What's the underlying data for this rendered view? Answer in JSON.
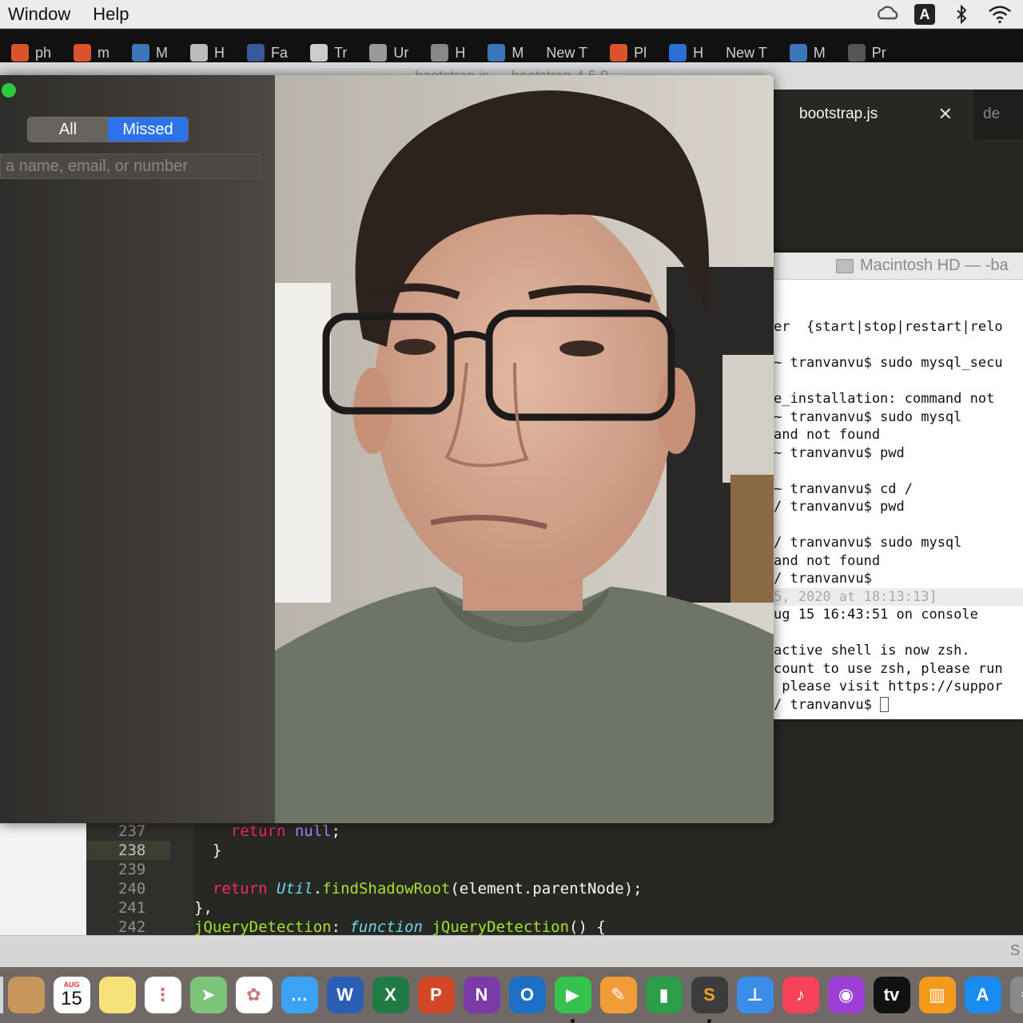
{
  "menubar": {
    "menus": [
      "Window",
      "Help"
    ],
    "status_a": "A"
  },
  "bookmarks": [
    {
      "label": "ph",
      "color": "#d9542b"
    },
    {
      "label": "m",
      "color": "#d9542b"
    },
    {
      "label": "M",
      "color": "#3a76b8"
    },
    {
      "label": "H",
      "color": "#bbbbbb"
    },
    {
      "label": "Fa",
      "color": "#3b5998"
    },
    {
      "label": "Tr",
      "color": "#cccccc"
    },
    {
      "label": "Ur",
      "color": "#999999"
    },
    {
      "label": "H",
      "color": "#888888"
    },
    {
      "label": "M",
      "color": "#3a76b8"
    },
    {
      "label": "New T",
      "color": ""
    },
    {
      "label": "Pl",
      "color": "#d9542b"
    },
    {
      "label": "H",
      "color": "#2b6fd6"
    },
    {
      "label": "New T",
      "color": ""
    },
    {
      "label": "M",
      "color": "#3a76b8"
    },
    {
      "label": "Pr",
      "color": "#555555"
    }
  ],
  "editor": {
    "title": "bootstrap.js — bootstrap-4.5.0",
    "tab_active": "bootstrap.js",
    "tab_next": "de",
    "line_numbers": [
      "237",
      "238",
      "239",
      "240",
      "241",
      "242"
    ]
  },
  "terminal": {
    "title": "Macintosh HD — -ba",
    "lines": [
      "er  {start|stop|restart|relo",
      "",
      "~ tranvanvu$ sudo mysql_secu",
      "",
      "e_installation: command not",
      "~ tranvanvu$ sudo mysql",
      "and not found",
      "~ tranvanvu$ pwd",
      "",
      "~ tranvanvu$ cd /",
      "/ tranvanvu$ pwd",
      "",
      "/ tranvanvu$ sudo mysql",
      "and not found",
      "/ tranvanvu$",
      "5, 2020 at 18:13:13]",
      "ug 15 16:43:51 on console",
      "",
      "active shell is now zsh.",
      "count to use zsh, please run",
      " please visit https://suppor",
      "/ tranvanvu$ "
    ]
  },
  "facetime": {
    "seg_all": "All",
    "seg_missed": "Missed",
    "search_placeholder": "a name, email, or number"
  },
  "statusbar": {
    "right": "S"
  },
  "dock": {
    "calendar_month": "AUG",
    "calendar_day": "15",
    "apps": [
      {
        "name": "contacts",
        "color": "#c8955a",
        "glyph": ""
      },
      {
        "name": "calendar",
        "color": "#ffffff",
        "glyph": ""
      },
      {
        "name": "notes",
        "color": "#f7e27a",
        "glyph": ""
      },
      {
        "name": "reminders",
        "color": "#ffffff",
        "glyph": "⋮"
      },
      {
        "name": "maps",
        "color": "#7cc47a",
        "glyph": "➤"
      },
      {
        "name": "photos",
        "color": "#ffffff",
        "glyph": "✿"
      },
      {
        "name": "messages",
        "color": "#3aa3f5",
        "glyph": "…"
      },
      {
        "name": "word",
        "color": "#2b5fb6",
        "glyph": "W"
      },
      {
        "name": "excel",
        "color": "#1f7a44",
        "glyph": "X"
      },
      {
        "name": "powerpoint",
        "color": "#d24726",
        "glyph": "P"
      },
      {
        "name": "onenote",
        "color": "#7a3aa8",
        "glyph": "N"
      },
      {
        "name": "outlook",
        "color": "#1d6fc6",
        "glyph": "O"
      },
      {
        "name": "facetime",
        "color": "#35c24d",
        "glyph": "▶"
      },
      {
        "name": "pages",
        "color": "#f29c38",
        "glyph": "✎"
      },
      {
        "name": "numbers",
        "color": "#2e9d4a",
        "glyph": "▮"
      },
      {
        "name": "sublime",
        "color": "#3c3c3c",
        "glyph": "S"
      },
      {
        "name": "keynote",
        "color": "#3a8ee8",
        "glyph": "⊥"
      },
      {
        "name": "music",
        "color": "#f5435a",
        "glyph": "♪"
      },
      {
        "name": "podcasts",
        "color": "#9b3fd6",
        "glyph": "◉"
      },
      {
        "name": "tv",
        "color": "#111111",
        "glyph": "tv"
      },
      {
        "name": "books",
        "color": "#f39a1c",
        "glyph": "▥"
      },
      {
        "name": "app-store",
        "color": "#1a8cf0",
        "glyph": "A"
      },
      {
        "name": "system-preferences",
        "color": "#8a8a8a",
        "glyph": "⚙"
      }
    ]
  }
}
